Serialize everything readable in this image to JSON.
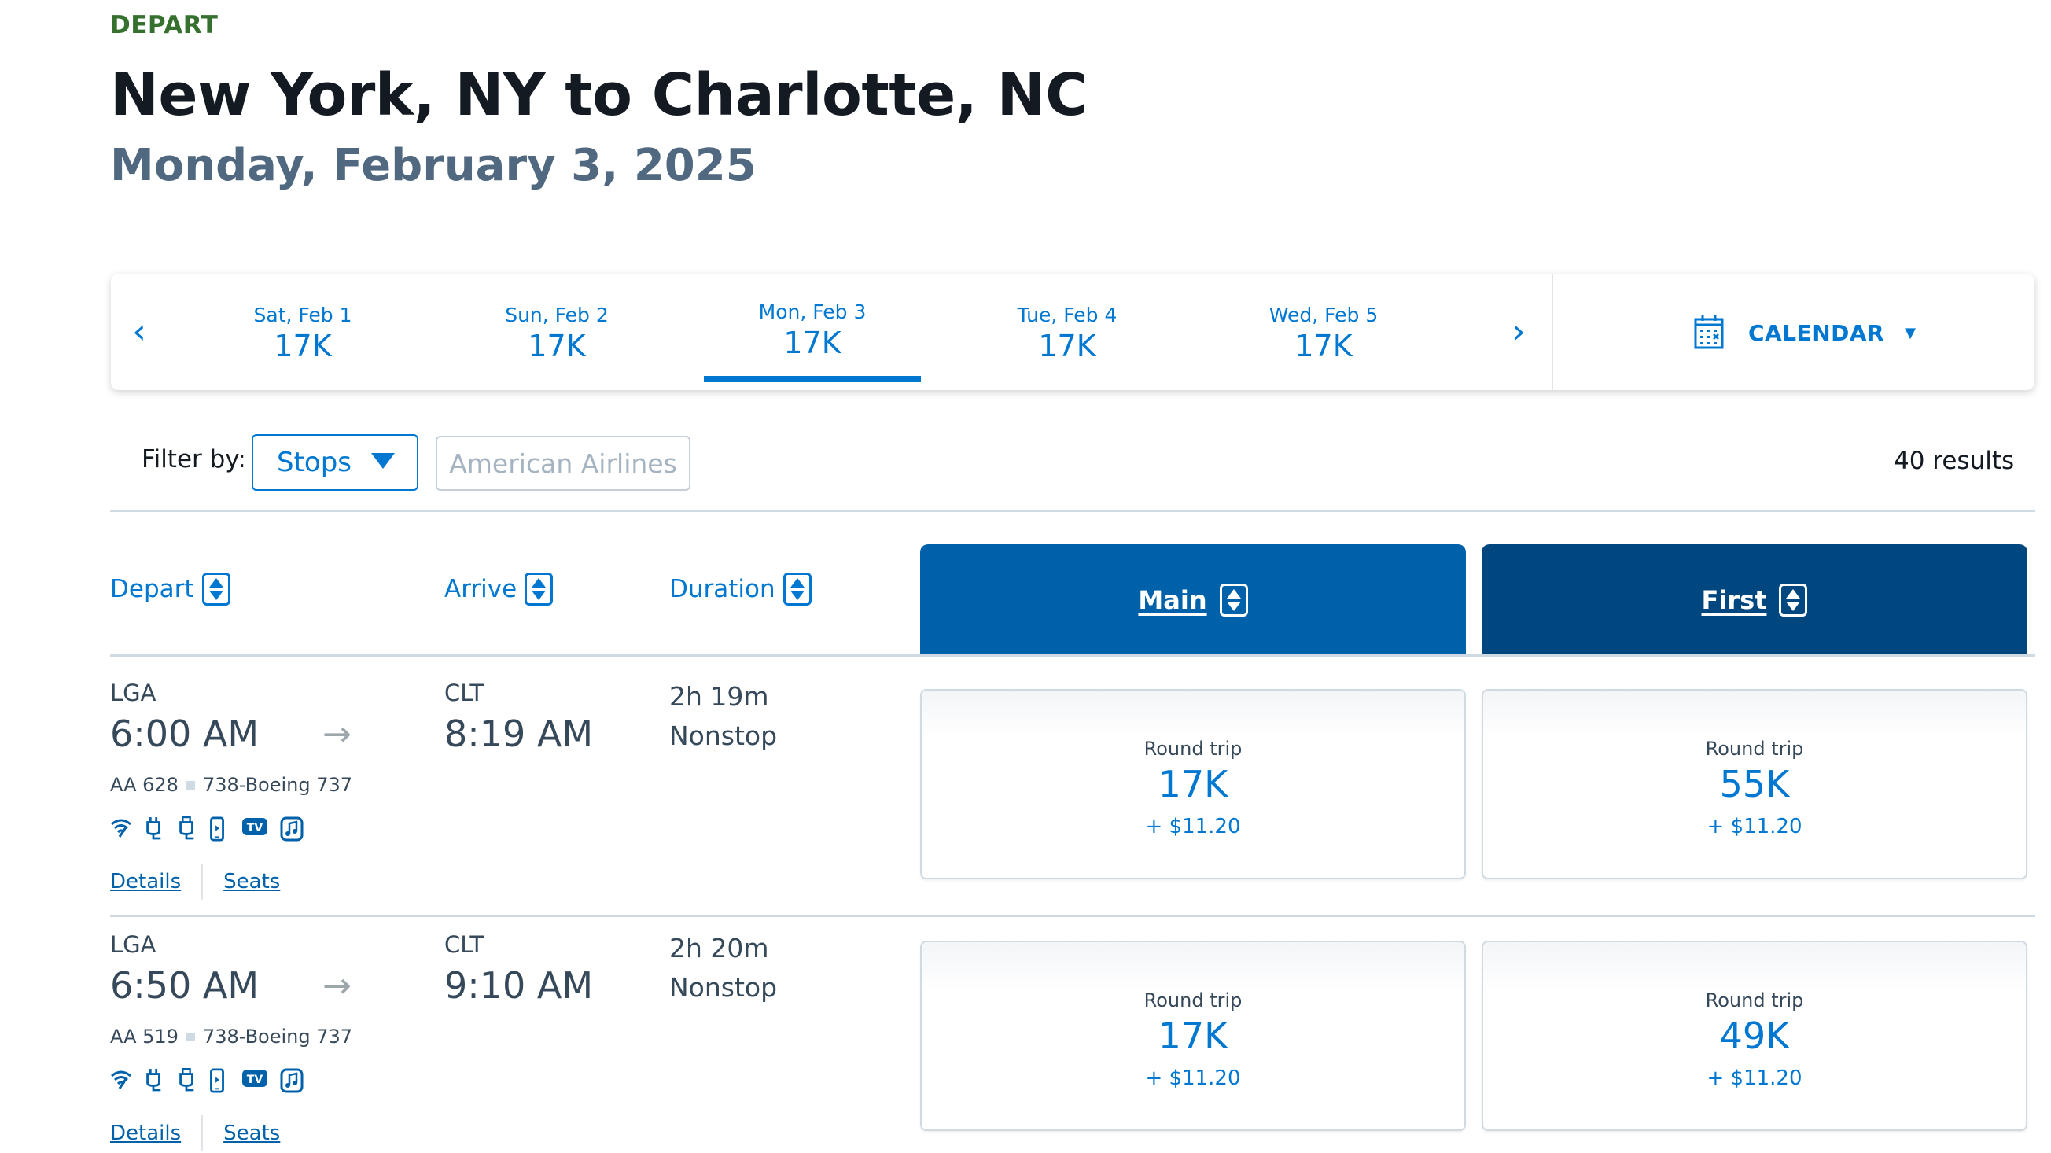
{
  "header": {
    "section_label": "DEPART",
    "route_title": "New York, NY to Charlotte, NC",
    "date": "Monday, February 3, 2025"
  },
  "carousel": {
    "prev_icon": "chevron-left-icon",
    "prev_glyph": "‹",
    "next_icon": "chevron-right-icon",
    "next_glyph": "›",
    "dates": [
      {
        "label": "Sat, Feb 1",
        "price": "17K",
        "selected": false
      },
      {
        "label": "Sun, Feb 2",
        "price": "17K",
        "selected": false
      },
      {
        "label": "Mon, Feb 3",
        "price": "17K",
        "selected": true
      },
      {
        "label": "Tue, Feb 4",
        "price": "17K",
        "selected": false
      },
      {
        "label": "Wed, Feb 5",
        "price": "17K",
        "selected": false
      }
    ],
    "calendar_label": "CALENDAR",
    "calendar_icon": "calendar-icon",
    "caret_glyph": "▼"
  },
  "filters": {
    "label": "Filter by:",
    "stops_value": "Stops",
    "airline_label": "American Airlines",
    "results": "40 results"
  },
  "columns": {
    "depart": "Depart",
    "arrive": "Arrive",
    "duration": "Duration",
    "main": "Main",
    "first": "First"
  },
  "colors": {
    "accent": "#0078d2",
    "main_header": "#0061ab",
    "first_header": "#00467f",
    "depart_label": "#36702e"
  },
  "flights": [
    {
      "origin": "LGA",
      "depart_time": "6:00 AM",
      "destination": "CLT",
      "arrive_time": "8:19 AM",
      "flight_number": "AA 628",
      "aircraft": "738-Boeing 737",
      "duration": "2h 19m",
      "stops": "Nonstop",
      "amenities": [
        "wifi-icon",
        "power-outlet-icon",
        "usb-icon",
        "streaming-device-icon",
        "tv-icon",
        "music-icon"
      ],
      "details_link": "Details",
      "seats_link": "Seats",
      "fares": {
        "main": {
          "trip": "Round trip",
          "miles": "17K",
          "tax": "+ $11.20"
        },
        "first": {
          "trip": "Round trip",
          "miles": "55K",
          "tax": "+ $11.20"
        }
      }
    },
    {
      "origin": "LGA",
      "depart_time": "6:50 AM",
      "destination": "CLT",
      "arrive_time": "9:10 AM",
      "flight_number": "AA 519",
      "aircraft": "738-Boeing 737",
      "duration": "2h 20m",
      "stops": "Nonstop",
      "amenities": [
        "wifi-icon",
        "power-outlet-icon",
        "usb-icon",
        "streaming-device-icon",
        "tv-icon",
        "music-icon"
      ],
      "details_link": "Details",
      "seats_link": "Seats",
      "fares": {
        "main": {
          "trip": "Round trip",
          "miles": "17K",
          "tax": "+ $11.20"
        },
        "first": {
          "trip": "Round trip",
          "miles": "49K",
          "tax": "+ $11.20"
        }
      }
    }
  ]
}
